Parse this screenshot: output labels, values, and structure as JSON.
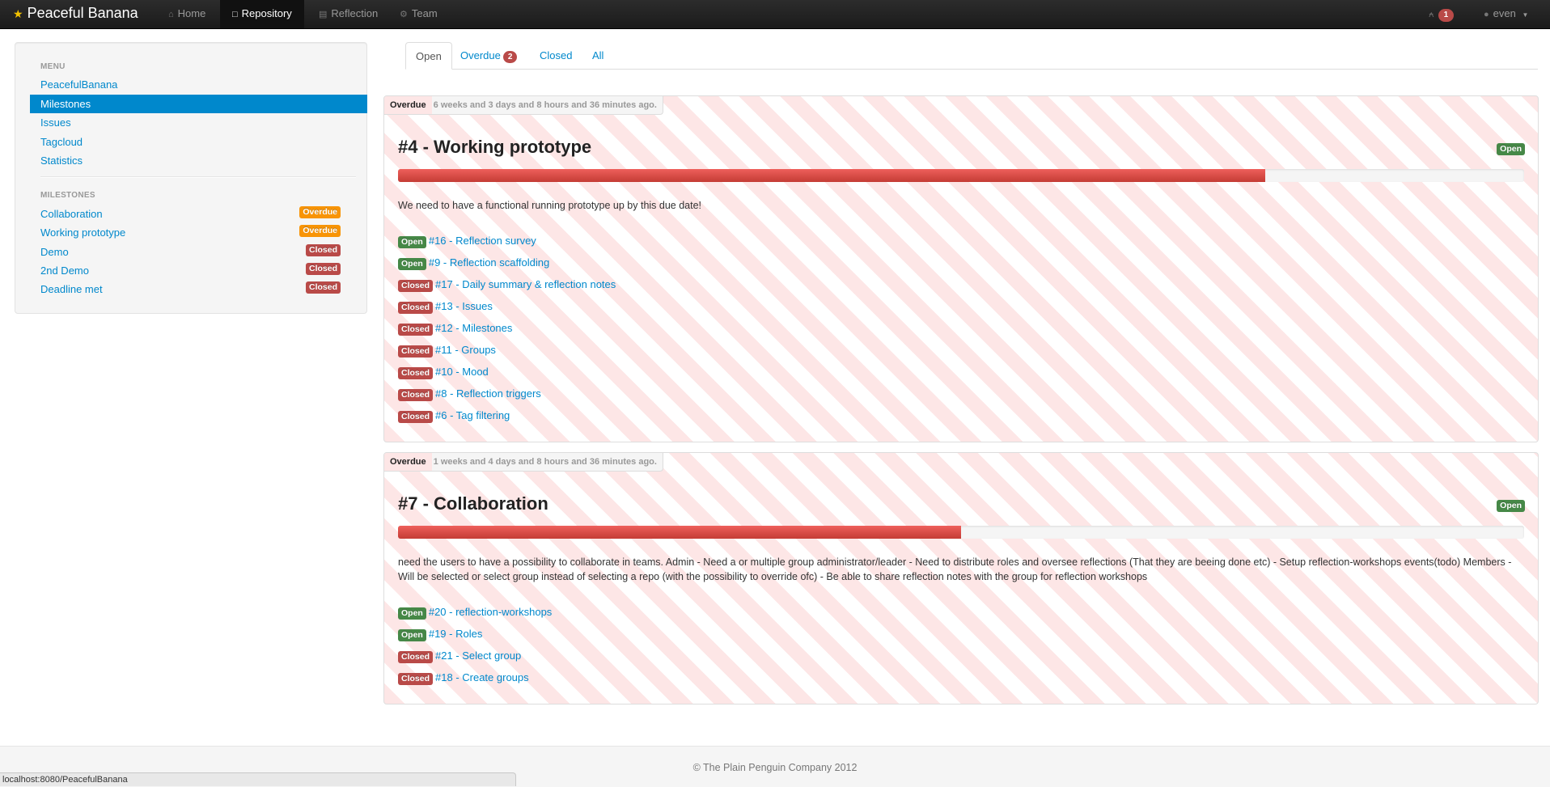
{
  "navbar": {
    "brand": "Peaceful Banana",
    "items": [
      {
        "label": "Home",
        "icon": "home-icon",
        "active": false
      },
      {
        "label": "Repository",
        "icon": "folder-icon",
        "active": true
      },
      {
        "label": "Reflection",
        "icon": "book-icon",
        "active": false
      },
      {
        "label": "Team",
        "icon": "cog-icon",
        "active": false
      }
    ],
    "notifications": "1",
    "user": "even"
  },
  "sidebar": {
    "menu_header": "MENU",
    "menu": [
      {
        "label": "PeacefulBanana",
        "active": false
      },
      {
        "label": "Milestones",
        "active": true
      },
      {
        "label": "Issues",
        "active": false
      },
      {
        "label": "Tagcloud",
        "active": false
      },
      {
        "label": "Statistics",
        "active": false
      }
    ],
    "milestones_header": "MILESTONES",
    "milestones": [
      {
        "label": "Collaboration",
        "status": "Overdue"
      },
      {
        "label": "Working prototype",
        "status": "Overdue"
      },
      {
        "label": "Demo",
        "status": "Closed"
      },
      {
        "label": "2nd Demo",
        "status": "Closed"
      },
      {
        "label": "Deadline met",
        "status": "Closed"
      }
    ]
  },
  "tabs": [
    {
      "label": "Open",
      "active": true,
      "badge": ""
    },
    {
      "label": "Overdue",
      "active": false,
      "badge": "2"
    },
    {
      "label": "Closed",
      "active": false,
      "badge": ""
    },
    {
      "label": "All",
      "active": false,
      "badge": ""
    }
  ],
  "milestones": [
    {
      "badge": "Overdue",
      "ago": "6 weeks and 3 days and 8 hours and 36 minutes ago.",
      "title": "#4 - Working prototype",
      "status": "Open",
      "progress": 0.77,
      "description": "We need to have a functional running prototype up by this due date!",
      "issues": [
        {
          "status": "Open",
          "title": "#16 - Reflection survey"
        },
        {
          "status": "Open",
          "title": "#9 - Reflection scaffolding"
        },
        {
          "status": "Closed",
          "title": "#17 - Daily summary & reflection notes"
        },
        {
          "status": "Closed",
          "title": "#13 - Issues"
        },
        {
          "status": "Closed",
          "title": "#12 - Milestones"
        },
        {
          "status": "Closed",
          "title": "#11 - Groups"
        },
        {
          "status": "Closed",
          "title": "#10 - Mood"
        },
        {
          "status": "Closed",
          "title": "#8 - Reflection triggers"
        },
        {
          "status": "Closed",
          "title": "#6 - Tag filtering"
        }
      ]
    },
    {
      "badge": "Overdue",
      "ago": "1 weeks and 4 days and 8 hours and 36 minutes ago.",
      "title": "#7 - Collaboration",
      "status": "Open",
      "progress": 0.5,
      "description": "need the users to have a possibility to collaborate in teams. Admin - Need a or multiple group administrator/leader - Need to distribute roles and oversee reflections (That they are beeing done etc) - Setup reflection-workshops events(todo) Members - Will be selected or select group instead of selecting a repo (with the possibility to override ofc) - Be able to share reflection notes with the group for reflection workshops",
      "issues": [
        {
          "status": "Open",
          "title": "#20 - reflection-workshops"
        },
        {
          "status": "Open",
          "title": "#19 - Roles"
        },
        {
          "status": "Closed",
          "title": "#21 - Select group"
        },
        {
          "status": "Closed",
          "title": "#18 - Create groups"
        }
      ]
    }
  ],
  "footer": "© The Plain Penguin Company 2012",
  "statusbar": "localhost:8080/PeacefulBanana",
  "colors": {
    "link": "#0088cc",
    "overdue": "#f89406",
    "closed": "#b94a48",
    "open": "#468847"
  }
}
